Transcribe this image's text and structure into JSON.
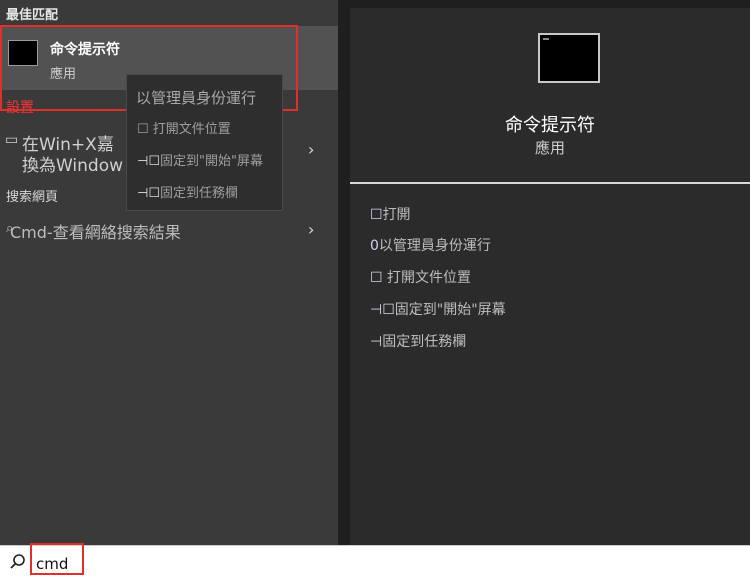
{
  "left": {
    "best_match_header": "最佳匹配",
    "best_match": {
      "name": "命令提示符",
      "type": "應用"
    },
    "settings_header": "設置",
    "settings_item": {
      "line1": "在Win+X嘉",
      "line2": "換為Window"
    },
    "web_header": "搜索網頁",
    "web_item": "Cmd-查看網絡搜索結果"
  },
  "context_menu": {
    "items": [
      "以管理員身份運行",
      "打開文件位置",
      "固定到\"開始\"屏幕",
      "固定到任務欄"
    ]
  },
  "detail": {
    "name": "命令提示符",
    "type": "應用",
    "actions": [
      {
        "glyph": "☐",
        "label": "打開"
      },
      {
        "glyph": "0",
        "label": "以管理員身份運行"
      },
      {
        "glyph": "☐",
        "label": " 打開文件位置"
      },
      {
        "glyph": "⊣☐",
        "label": "固定到\"開始\"屏幕"
      },
      {
        "glyph": "⊣",
        "label": "固定到任務欄"
      }
    ]
  },
  "search": {
    "query": "cmd"
  },
  "colors": {
    "highlight_border": "#e0302a",
    "settings_header": "#ff3333"
  }
}
